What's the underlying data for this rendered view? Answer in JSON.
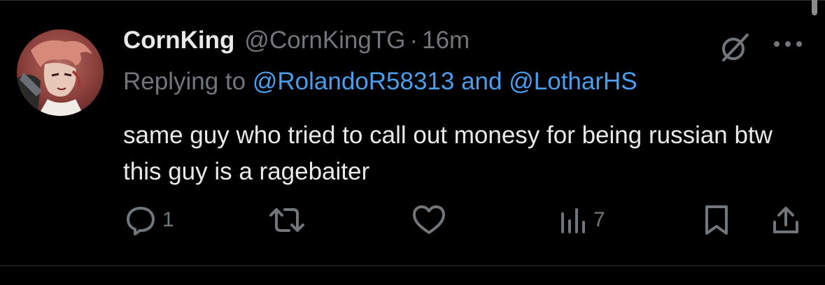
{
  "tweet": {
    "display_name": "CornKing",
    "handle": "@CornKingTG",
    "separator": "·",
    "time": "16m",
    "replying_prefix": "Replying to",
    "reply_user_1": "@RolandoR58313",
    "reply_joiner": "and",
    "reply_user_2": "@LotharHS",
    "text": "same guy who tried to call out monesy for being russian btw this guy is a ragebaiter"
  },
  "actions": {
    "reply_count": "1",
    "retweet_count": "",
    "like_count": "",
    "views_count": "7"
  },
  "icons": {
    "grok": "grok-icon",
    "more": "more-dots-icon",
    "reply": "reply-bubble-icon",
    "retweet": "retweet-icon",
    "like": "heart-icon",
    "views": "views-bar-chart-icon",
    "bookmark": "bookmark-icon",
    "share": "share-upload-icon"
  },
  "colors": {
    "background": "#000000",
    "primary_text": "#e7e9ea",
    "secondary_text": "#71767b",
    "link": "#4a9eed",
    "divider": "#2f3336"
  }
}
